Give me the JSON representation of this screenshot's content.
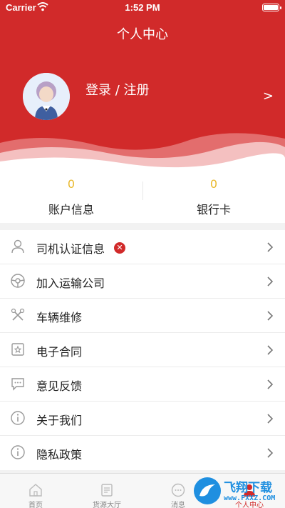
{
  "status_bar": {
    "carrier": "Carrier",
    "time": "1:52 PM"
  },
  "header": {
    "title": "个人中心",
    "login_label": "登录 / 注册",
    "arrow": ">",
    "brand_color": "#d12a2a"
  },
  "stats": [
    {
      "value": "0",
      "label": "账户信息"
    },
    {
      "value": "0",
      "label": "银行卡"
    }
  ],
  "menu": [
    {
      "label": "司机认证信息",
      "icon": "person-icon",
      "badge": "✕"
    },
    {
      "label": "加入运输公司",
      "icon": "steering-wheel-icon"
    },
    {
      "label": "车辆维修",
      "icon": "wrench-icon"
    },
    {
      "label": "电子合同",
      "icon": "contract-icon"
    },
    {
      "label": "意见反馈",
      "icon": "chat-icon"
    },
    {
      "label": "关于我们",
      "icon": "info-icon"
    },
    {
      "label": "隐私政策",
      "icon": "info-icon"
    }
  ],
  "tabbar": [
    {
      "label": "首页",
      "icon": "home-icon"
    },
    {
      "label": "货源大厅",
      "icon": "document-icon"
    },
    {
      "label": "消息",
      "icon": "message-icon"
    },
    {
      "label": "个人中心",
      "icon": "person-icon",
      "active": true
    }
  ],
  "watermark": {
    "title": "飞翔下载",
    "url": "www.FXXZ.COM"
  }
}
